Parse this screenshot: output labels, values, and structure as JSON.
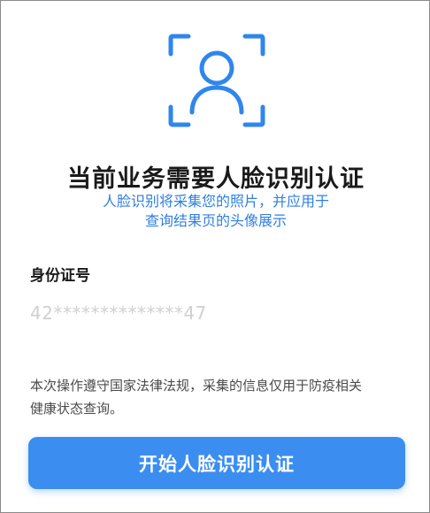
{
  "colors": {
    "accent": "#3b8ef0",
    "subtitle": "#2f7fe0",
    "title": "#1a1a1a",
    "placeholder": "#d0d0d0",
    "notice": "#4a4a4a"
  },
  "header": {
    "icon": "face-recognition-icon",
    "title": "当前业务需要人脸识别认证",
    "subtitle_line1": "人脸识别将采集您的照片，并应用于",
    "subtitle_line2": "查询结果页的头像展示"
  },
  "form": {
    "id_label": "身份证号",
    "id_placeholder": "42**************47"
  },
  "notice": {
    "line1": "本次操作遵守国家法律法规，采集的信息仅用于防疫相关",
    "line2": "健康状态查询。"
  },
  "actions": {
    "start_label": "开始人脸识别认证"
  }
}
